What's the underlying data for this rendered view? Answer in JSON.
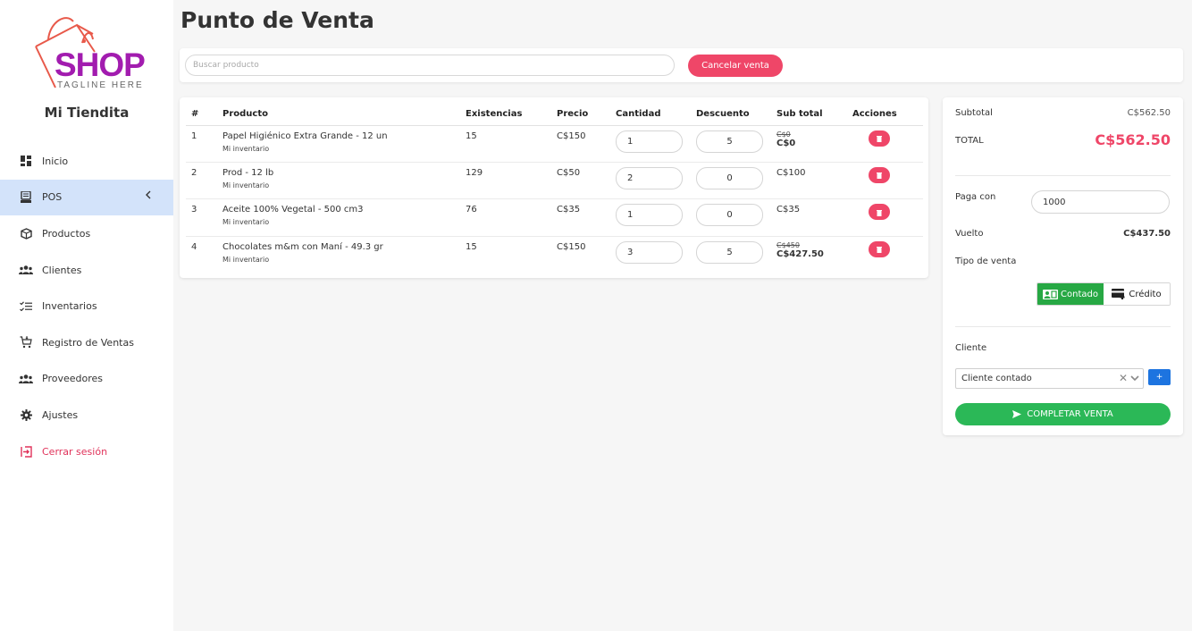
{
  "sidebar": {
    "logo_text": "SHOP",
    "logo_tagline": "TAGLINE HERE",
    "store_name": "Mi Tiendita",
    "items": [
      {
        "label": "Inicio",
        "icon": "dashboard-icon"
      },
      {
        "label": "POS",
        "icon": "pos-register-icon"
      },
      {
        "label": "Productos",
        "icon": "box-icon"
      },
      {
        "label": "Clientes",
        "icon": "users-icon"
      },
      {
        "label": "Inventarios",
        "icon": "checklist-icon"
      },
      {
        "label": "Registro de Ventas",
        "icon": "cart-icon"
      },
      {
        "label": "Proveedores",
        "icon": "users-icon"
      },
      {
        "label": "Ajustes",
        "icon": "gear-icon"
      },
      {
        "label": "Cerrar sesión",
        "icon": "logout-icon"
      }
    ],
    "active_item": "POS"
  },
  "header": {
    "title": "Punto de Venta"
  },
  "search": {
    "placeholder": "Buscar producto",
    "cancel_label": "Cancelar venta"
  },
  "table": {
    "headers": [
      "#",
      "Producto",
      "Existencias",
      "Precio",
      "Cantidad",
      "Descuento",
      "Sub total",
      "Acciones"
    ],
    "rows": [
      {
        "num": "1",
        "product": "Papel Higiénico Extra Grande - 12 un",
        "inventory": "Mi inventario",
        "stock": "15",
        "price": "C$150",
        "qty": "1",
        "discount": "5",
        "subtotal_original": "C$0",
        "subtotal": "C$0"
      },
      {
        "num": "2",
        "product": "Prod - 12 lb",
        "inventory": "Mi inventario",
        "stock": "129",
        "price": "C$50",
        "qty": "2",
        "discount": "0",
        "subtotal_original": "",
        "subtotal": "C$100"
      },
      {
        "num": "3",
        "product": "Aceite 100% Vegetal - 500 cm3",
        "inventory": "Mi inventario",
        "stock": "76",
        "price": "C$35",
        "qty": "1",
        "discount": "0",
        "subtotal_original": "",
        "subtotal": "C$35"
      },
      {
        "num": "4",
        "product": "Chocolates m&m con Maní - 49.3 gr",
        "inventory": "Mi inventario",
        "stock": "15",
        "price": "C$150",
        "qty": "3",
        "discount": "5",
        "subtotal_original": "C$450",
        "subtotal": "C$427.50"
      }
    ]
  },
  "summary": {
    "subtotal_label": "Subtotal",
    "subtotal_value": "C$562.50",
    "total_label": "TOTAL",
    "total_value": "C$562.50",
    "pay_label": "Paga con",
    "pay_value": "1000",
    "change_label": "Vuelto",
    "change_value": "C$437.50",
    "sale_type_label": "Tipo de venta",
    "sale_type_cash": "Contado",
    "sale_type_credit": "Crédito",
    "client_label": "Cliente",
    "client_value": "Cliente contado",
    "add_client_label": "+",
    "complete_label": "COMPLETAR VENTA"
  },
  "colors": {
    "accent_red": "#ef4668",
    "accent_green": "#2bb857",
    "active_nav": "#d3e3fa",
    "brand_purple": "#a21caf",
    "logo_bag": "#e8594a"
  }
}
